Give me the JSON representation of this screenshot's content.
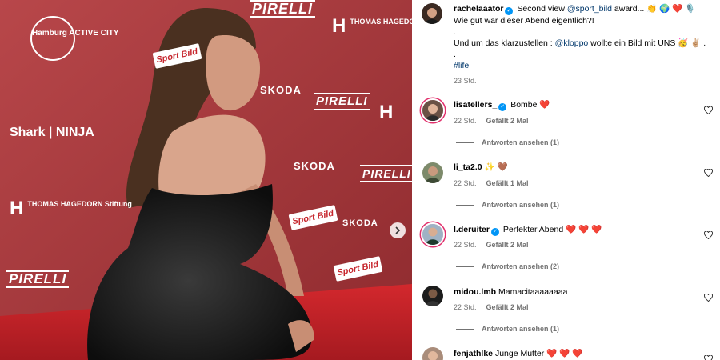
{
  "post": {
    "author": "rachelaaator",
    "caption_line1": " Second view ",
    "mention1": "@sport_bild",
    "caption_line1_end": " award... ",
    "caption_line1_emojis": "👏 🌍 ❤️ 🎙️",
    "caption_line2": "Wie gut war dieser Abend eigentlich?!",
    "caption_dot1": ".",
    "caption_line3_start": "Und um das klarzustellen : ",
    "mention2": "@kloppo",
    "caption_line3_end": " wollte ein Bild mit UNS ",
    "caption_line3_emojis": "🥳 ✌🏼 .",
    "caption_dot2": ".",
    "hashtag": "#life",
    "time": "23 Std."
  },
  "comments": [
    {
      "user": "lisatellers_",
      "verified": true,
      "text": "Bombe ",
      "emoji": "❤️",
      "time": "22 Std.",
      "likes": "Gefällt 2 Mal",
      "replies": "Antworten ansehen (1)"
    },
    {
      "user": "li_ta2.0",
      "verified": false,
      "text": "",
      "emoji": "✨ 🤎",
      "time": "22 Std.",
      "likes": "Gefällt 1 Mal",
      "replies": "Antworten ansehen (1)"
    },
    {
      "user": "l.deruiter",
      "verified": true,
      "text": "Perfekter Abend ",
      "emoji": "❤️ ❤️ ❤️",
      "time": "22 Std.",
      "likes": "Gefällt 2 Mal",
      "replies": "Antworten ansehen (2)"
    },
    {
      "user": "midou.lmb",
      "verified": false,
      "text": "Mamacitaaaaaaaa",
      "emoji": "",
      "time": "22 Std.",
      "likes": "Gefällt 2 Mal",
      "replies": "Antworten ansehen (1)"
    },
    {
      "user": "fenjathlke",
      "verified": false,
      "text": "Junge Mutter ",
      "emoji": "❤️ ❤️ ❤️",
      "time": "",
      "likes": "",
      "replies": ""
    }
  ],
  "backdrop_logos": {
    "pirelli": "PIRELLI",
    "skoda": "SKODA",
    "shark": "Shark | NINJA",
    "thomas_h": "H",
    "thomas_text": "THOMAS HAGEDORN Stiftung",
    "sport": "Sport Bild",
    "active_city": "Hamburg ACTIVE CITY"
  },
  "colors": {
    "backdrop": "#b03a3c",
    "carpet": "#c0262c",
    "link": "#00376b",
    "verified": "#0095f6",
    "like": "#ed4956"
  }
}
